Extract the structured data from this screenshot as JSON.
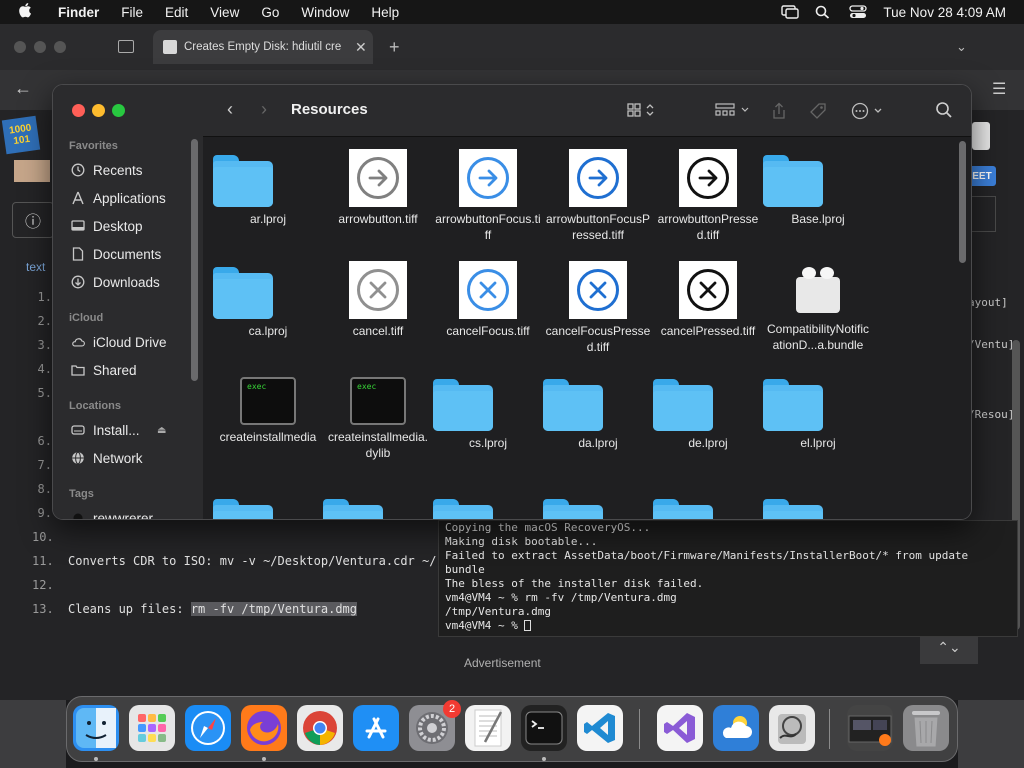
{
  "menubar": {
    "app_name": "Finder",
    "menus": [
      "File",
      "Edit",
      "View",
      "Go",
      "Window",
      "Help"
    ],
    "clock": "Tue Nov 28  4:09 AM"
  },
  "browser": {
    "tab_title": "Creates Empty Disk: hdiutil cre"
  },
  "webpage": {
    "code_label": "text",
    "line_numbers": [
      "1.",
      "2.",
      "3.",
      "4.",
      "5.",
      "6.",
      "7.",
      "8.",
      "9.",
      "10.",
      "11.",
      "12.",
      "13."
    ],
    "code_lines": {
      "l11": "Converts CDR to ISO: mv -v ~/Desktop/Ventura.cdr ~/",
      "l13_prefix": "Cleans up files: ",
      "l13_cmd": "rm -fv /tmp/Ventura.dmg"
    },
    "right_fragments": [
      "ayout]",
      "/Ventu]",
      "/Resou]"
    ],
    "sheet_button": "EET",
    "advertisement": "Advertisement"
  },
  "terminal": {
    "lines": [
      "Copying the macOS RecoveryOS...",
      "Making disk bootable...",
      "Failed to extract AssetData/boot/Firmware/Manifests/InstallerBoot/* from update",
      "bundle",
      "The bless of the installer disk failed.",
      "vm4@VM4 ~ % rm -fv /tmp/Ventura.dmg",
      "/tmp/Ventura.dmg",
      "vm4@VM4 ~ % "
    ]
  },
  "finder": {
    "title": "Resources",
    "sidebar": {
      "favorites_label": "Favorites",
      "favorites": [
        "Recents",
        "Applications",
        "Desktop",
        "Documents",
        "Downloads"
      ],
      "icloud_label": "iCloud",
      "icloud": [
        "iCloud Drive",
        "Shared"
      ],
      "locations_label": "Locations",
      "locations": [
        "Install...",
        "Network"
      ],
      "tags_label": "Tags",
      "tags": [
        "rewwrerer"
      ]
    },
    "items": [
      {
        "name": "ar.lproj",
        "kind": "folder"
      },
      {
        "name": "arrowbutton.tiff",
        "kind": "arrow",
        "color": "#808080"
      },
      {
        "name": "arrowbuttonFocus.tiff",
        "kind": "arrow",
        "color": "#3a8ee6"
      },
      {
        "name": "arrowbuttonFocusPressed.tiff",
        "kind": "arrow",
        "color": "#1f6fd1"
      },
      {
        "name": "arrowbuttonPressed.tiff",
        "kind": "arrow",
        "color": "#111111"
      },
      {
        "name": "Base.lproj",
        "kind": "folder"
      },
      {
        "name": "ca.lproj",
        "kind": "folder"
      },
      {
        "name": "cancel.tiff",
        "kind": "cancel",
        "color": "#909090"
      },
      {
        "name": "cancelFocus.tiff",
        "kind": "cancel",
        "color": "#3a8ee6"
      },
      {
        "name": "cancelFocusPressed.tiff",
        "kind": "cancel",
        "color": "#1f6fd1"
      },
      {
        "name": "cancelPressed.tiff",
        "kind": "cancel",
        "color": "#111111"
      },
      {
        "name": "CompatibilityNotificationD...a.bundle",
        "kind": "bundle"
      },
      {
        "name": "createinstallmedia",
        "kind": "exec",
        "label": "exec"
      },
      {
        "name": "createinstallmedia.dylib",
        "kind": "exec",
        "label": "exec"
      },
      {
        "name": "cs.lproj",
        "kind": "folder"
      },
      {
        "name": "da.lproj",
        "kind": "folder"
      },
      {
        "name": "de.lproj",
        "kind": "folder"
      },
      {
        "name": "el.lproj",
        "kind": "folder"
      }
    ]
  },
  "dock": {
    "apps": [
      {
        "name": "Finder",
        "icon": "finder-icon",
        "color": "#2d8ff0",
        "running": true
      },
      {
        "name": "Launchpad",
        "icon": "launchpad-icon",
        "color": "#e6e6e6",
        "running": false
      },
      {
        "name": "Safari",
        "icon": "safari-icon",
        "color": "#1a8cf5",
        "running": false
      },
      {
        "name": "Firefox",
        "icon": "firefox-icon",
        "color": "#ff7a1a",
        "running": true
      },
      {
        "name": "Chrome",
        "icon": "chrome-icon",
        "color": "#e9e9e9",
        "running": false
      },
      {
        "name": "App Store",
        "icon": "app-store-icon",
        "color": "#1f8ff5",
        "running": false
      },
      {
        "name": "System Settings",
        "icon": "settings-icon",
        "color": "#8e8e93",
        "running": false,
        "badge": "2"
      },
      {
        "name": "TextEdit",
        "icon": "textedit-icon",
        "color": "#f2f2f2",
        "running": false
      },
      {
        "name": "Terminal",
        "icon": "terminal-icon",
        "color": "#222222",
        "running": true
      },
      {
        "name": "VS Code",
        "icon": "vscode-icon",
        "color": "#f4f4f4",
        "running": false
      },
      {
        "name": "Visual Studio",
        "icon": "visual-studio-icon",
        "color": "#f4f4f4",
        "running": false
      },
      {
        "name": "Weather",
        "icon": "weather-icon",
        "color": "#2f7fd8",
        "running": false
      },
      {
        "name": "Disk Utility",
        "icon": "disk-utility-icon",
        "color": "#e8e8e8",
        "running": false
      },
      {
        "name": "Downloads Stack",
        "icon": "downloads-stack-icon",
        "color": "#444444",
        "running": false
      },
      {
        "name": "Trash",
        "icon": "trash-icon",
        "color": "#8a8a8c",
        "running": false
      }
    ]
  }
}
